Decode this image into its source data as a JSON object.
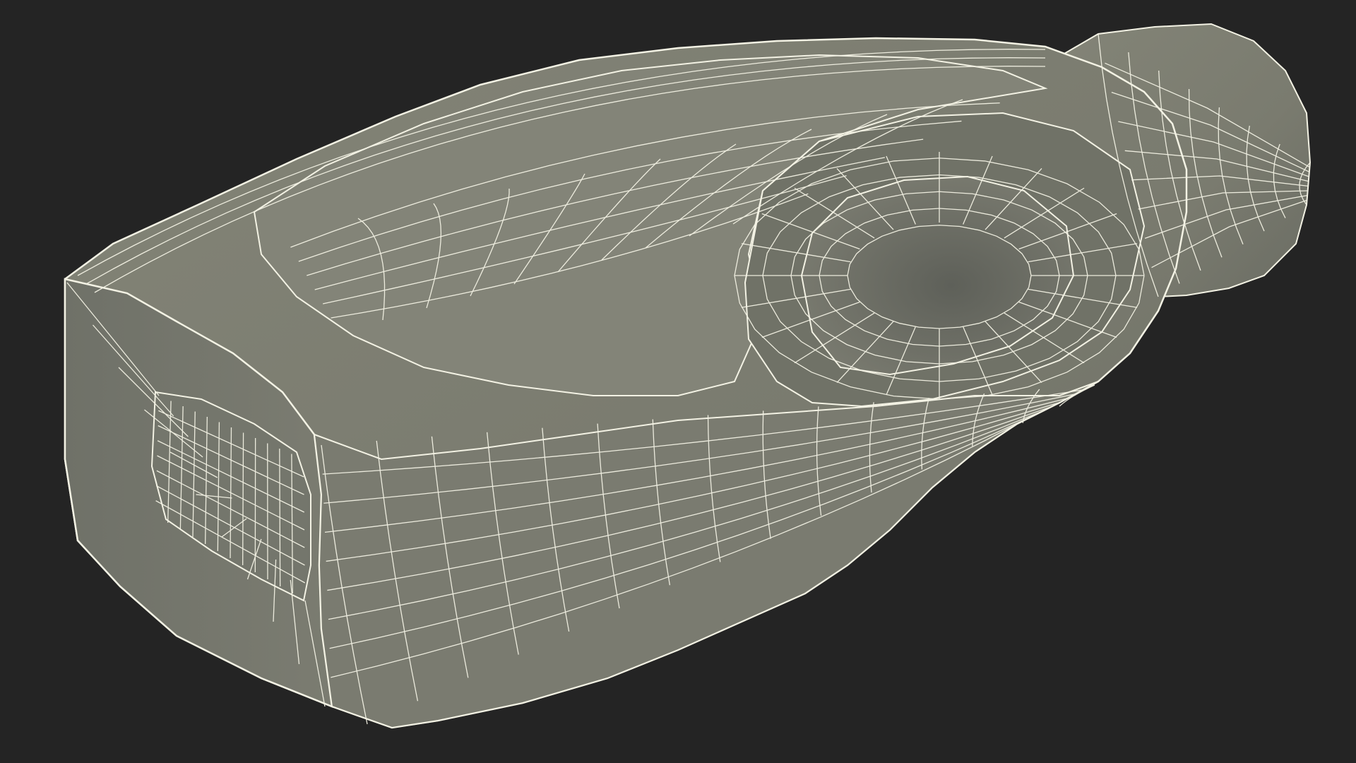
{
  "scene": {
    "object": "wireframe-bottle-mesh",
    "colors": {
      "background": "#242424",
      "surface_light": "#7f7f73",
      "surface_mid": "#75766b",
      "surface_dark": "#5d5f57",
      "inner_cavity": "#6b6d64",
      "wire": "#f3f2e4"
    }
  }
}
